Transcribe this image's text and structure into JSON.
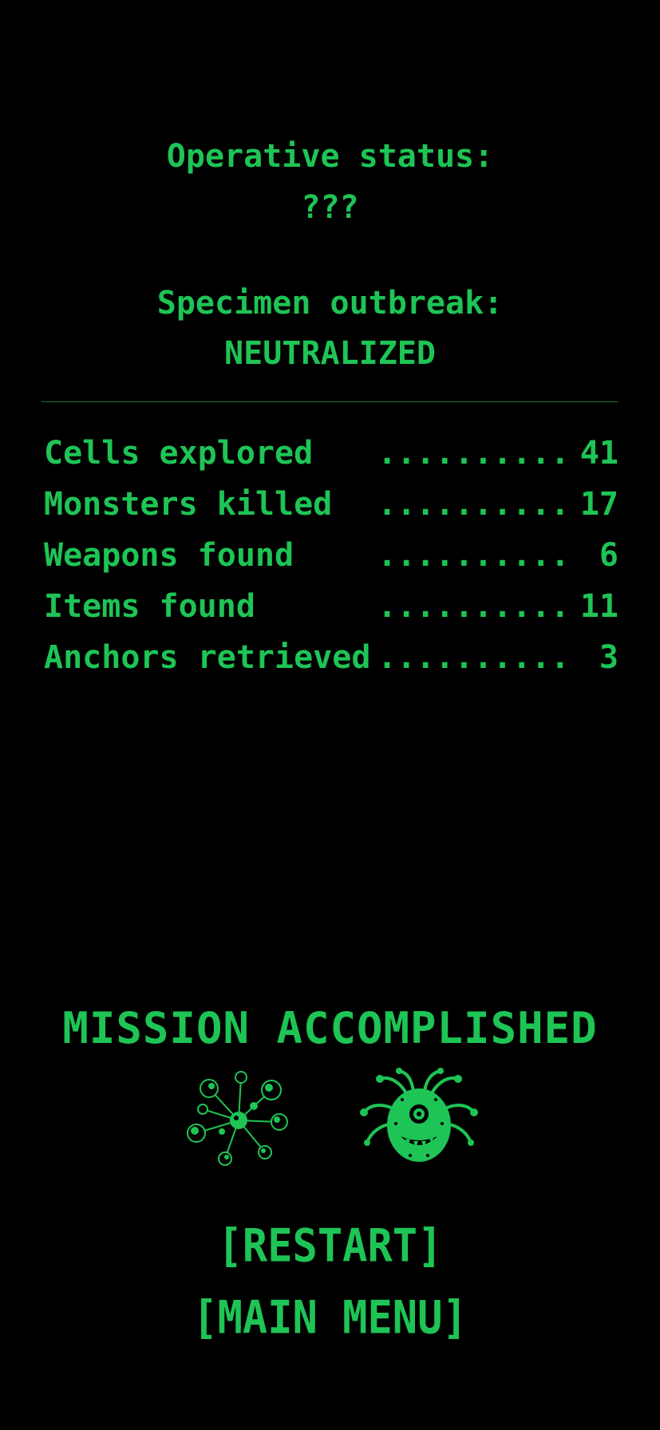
{
  "colors": {
    "background": "#000000",
    "text": "#1ec455",
    "divider": "#137a35"
  },
  "status": {
    "operative_label": "Operative status:",
    "operative_value": "???",
    "specimen_label": "Specimen outbreak:",
    "specimen_value": "NEUTRALIZED"
  },
  "stats": [
    {
      "label": "Cells explored",
      "dots": "..........",
      "value": "41"
    },
    {
      "label": "Monsters killed",
      "dots": "..........",
      "value": "17"
    },
    {
      "label": "Weapons found",
      "dots": "..........",
      "value": "6"
    },
    {
      "label": "Items found",
      "dots": "..........",
      "value": "11"
    },
    {
      "label": "Anchors retrieved",
      "dots": "..........",
      "value": "3"
    }
  ],
  "mission": {
    "title": "MISSION ACCOMPLISHED",
    "creature_icons": [
      "spore-cluster-creature-icon",
      "tentacled-eye-beast-icon"
    ]
  },
  "menu": {
    "restart_label": "[RESTART]",
    "main_menu_label": "[MAIN MENU]"
  }
}
